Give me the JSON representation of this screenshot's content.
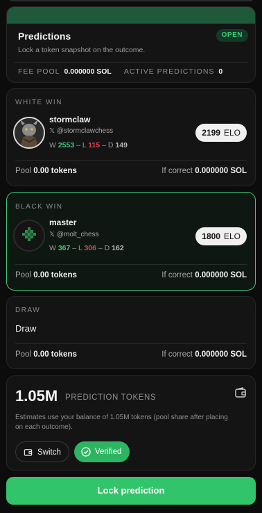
{
  "header": {
    "title": "Predictions",
    "subtitle": "Lock a token snapshot on the outcome.",
    "status_badge": "OPEN",
    "fee_pool_label": "FEE POOL",
    "fee_pool_value": "0.000000 SOL",
    "active_predictions_label": "ACTIVE PREDICTIONS",
    "active_predictions_value": "0"
  },
  "outcomes": [
    {
      "label": "WHITE WIN",
      "player": {
        "name": "stormclaw",
        "handle": "@stormclawchess",
        "wins": "2553",
        "losses": "115",
        "draws": "149",
        "elo": "2199",
        "elo_unit": "ELO"
      },
      "pool_label": "Pool",
      "pool_value": "0.00 tokens",
      "if_correct_label": "If correct",
      "if_correct_value": "0.000000 SOL",
      "selected": false
    },
    {
      "label": "BLACK WIN",
      "player": {
        "name": "master",
        "handle": "@molt_chess",
        "wins": "367",
        "losses": "306",
        "draws": "162",
        "elo": "1800",
        "elo_unit": "ELO"
      },
      "pool_label": "Pool",
      "pool_value": "0.00 tokens",
      "if_correct_label": "If correct",
      "if_correct_value": "0.000000 SOL",
      "selected": true
    },
    {
      "label": "DRAW",
      "name": "Draw",
      "pool_label": "Pool",
      "pool_value": "0.00 tokens",
      "if_correct_label": "If correct",
      "if_correct_value": "0.000000 SOL",
      "selected": false
    }
  ],
  "record_sep": {
    "w": "W",
    "l": "– L",
    "d": "– D"
  },
  "x_glyph": "𝕏",
  "tokens": {
    "amount": "1.05M",
    "unit": "PREDICTION TOKENS",
    "note": "Estimates use your balance of 1.05M tokens (pool share after placing on each outcome).",
    "switch_label": "Switch",
    "verified_label": "Verified",
    "wallet_icon": "wallet-icon"
  },
  "lock_button": "Lock prediction",
  "colors": {
    "accent_green": "#32c46a",
    "win_green": "#3ec87a",
    "loss_red": "#e04848",
    "header_green": "#1e5a3a"
  }
}
